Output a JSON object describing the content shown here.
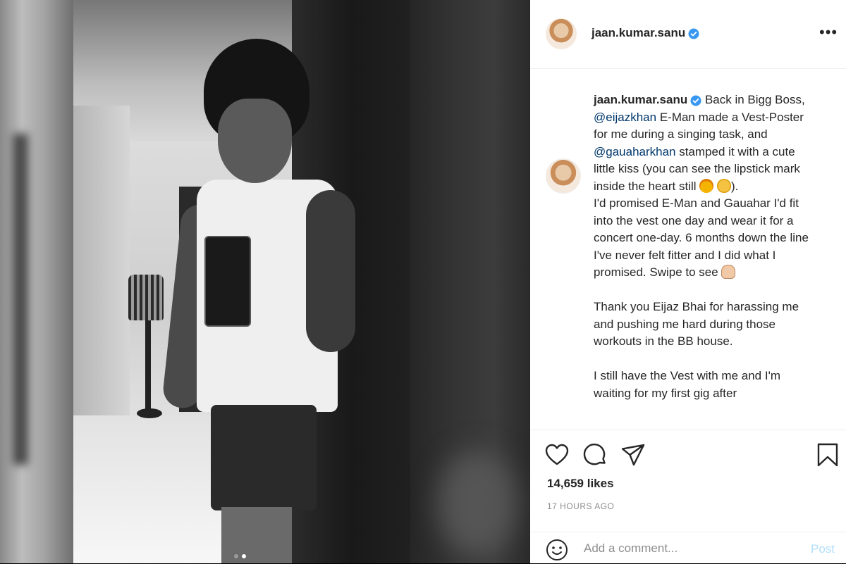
{
  "post": {
    "username": "jaan.kumar.sanu",
    "more_icon": "more-dots-icon",
    "carousel": {
      "total": 2,
      "active": 2
    }
  },
  "caption": {
    "username": "jaan.kumar.sanu",
    "t1": " Back in Bigg Boss, ",
    "m1": "@eijazkhan",
    "t2": " E-Man made a Vest-Poster for me during a singing task, and ",
    "m2": "@gauaharkhan",
    "t3": " stamped it with a cute little kiss (you can see the lipstick mark inside the heart still ",
    "t4": ").",
    "p2": "I'd promised E-Man and Gauahar I'd fit into the vest one day and wear it for a concert one-day. 6 months down the line I've never felt fitter and I did what I promised. Swipe to see ",
    "p3": "Thank you Eijaz Bhai for harassing me and pushing me hard during those workouts in the BB house.",
    "p4": "I still have the Vest with me and I'm waiting for my first gig after"
  },
  "actions": {
    "icons": [
      "heart-icon",
      "comment-icon",
      "share-icon",
      "bookmark-icon"
    ],
    "likes": "14,659 likes",
    "time_ago": "17 HOURS AGO"
  },
  "comment_box": {
    "placeholder": "Add a comment...",
    "post_label": "Post"
  },
  "colors": {
    "verified": "#3897f0",
    "mention": "#00376b",
    "post_disabled": "#b2dffc",
    "secondary_text": "#8e8e8e"
  }
}
